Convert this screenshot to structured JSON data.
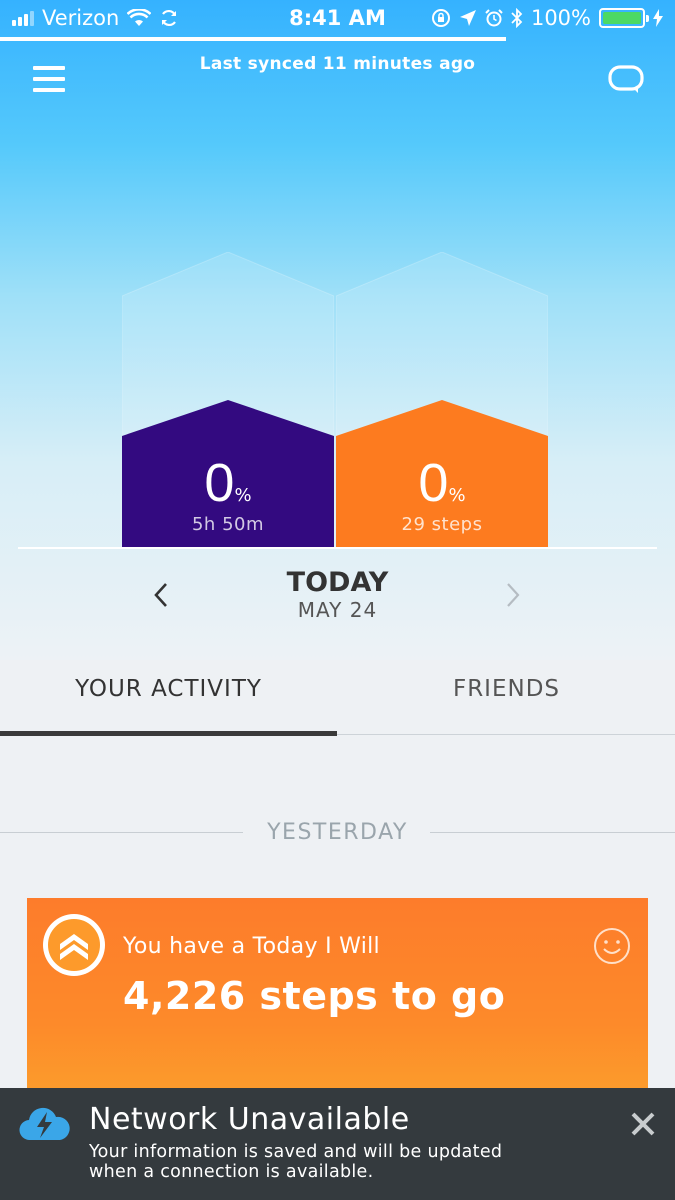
{
  "status_bar": {
    "carrier": "Verizon",
    "time": "8:41 AM",
    "battery": "100%",
    "sync_progress": 0.75
  },
  "header": {
    "sync_text": "Last synced 11 minutes ago"
  },
  "goals": {
    "sleep": {
      "percent": "0",
      "percent_sign": "%",
      "detail": "5h 50m",
      "color": "#330a80"
    },
    "steps": {
      "percent": "0",
      "percent_sign": "%",
      "detail": "29 steps",
      "color": "#fd7b1f"
    }
  },
  "date_nav": {
    "title": "TODAY",
    "date": "MAY 24"
  },
  "tabs": [
    {
      "label": "YOUR ACTIVITY",
      "active": true
    },
    {
      "label": "FRIENDS",
      "active": false
    }
  ],
  "feed": {
    "section_label": "YESTERDAY",
    "card": {
      "title": "You have a Today I Will",
      "headline": "4,226 steps to go",
      "accent": "#fd7c2b"
    }
  },
  "toast": {
    "title": "Network Unavailable",
    "message": "Your information is saved and will be updated when a connection is available.",
    "background": "#343a3e"
  },
  "icons": [
    "menu-icon",
    "chat-bubble-icon",
    "chevron-left-icon",
    "chevron-right-icon",
    "double-chevron-up-icon",
    "smiley-icon",
    "cloud-lightning-icon",
    "close-icon"
  ]
}
